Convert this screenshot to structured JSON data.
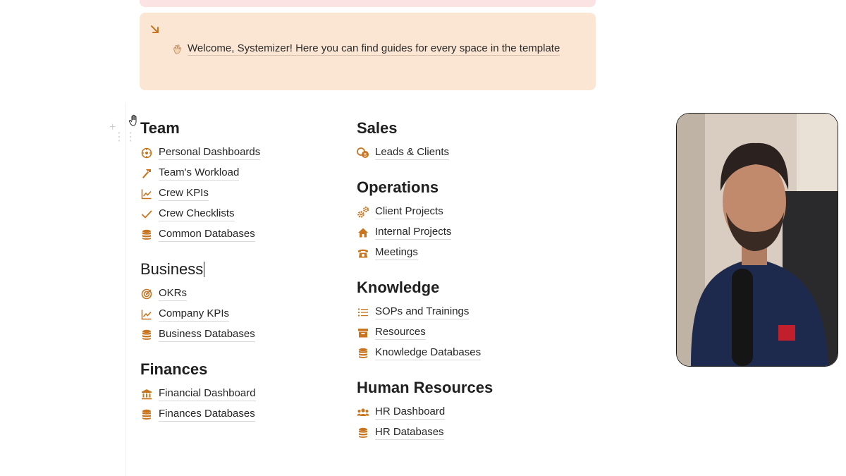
{
  "callout": {
    "text": "Welcome, Systemizer! Here you can find guides for every space in the template",
    "accent": "#c9741f"
  },
  "left_column": [
    {
      "heading": "Team",
      "items": [
        {
          "label": "Personal Dashboards",
          "icon": "dashboard-icon"
        },
        {
          "label": "Team's Workload",
          "icon": "hammer-icon"
        },
        {
          "label": "Crew KPIs",
          "icon": "trend-icon"
        },
        {
          "label": "Crew Checklists",
          "icon": "check-icon"
        },
        {
          "label": "Common Databases",
          "icon": "database-icon"
        }
      ]
    },
    {
      "heading": "Business",
      "items": [
        {
          "label": "OKRs",
          "icon": "target-icon"
        },
        {
          "label": "Company KPIs",
          "icon": "trend-icon"
        },
        {
          "label": "Business Databases",
          "icon": "database-icon"
        }
      ]
    },
    {
      "heading": "Finances",
      "items": [
        {
          "label": "Financial Dashboard",
          "icon": "bank-icon"
        },
        {
          "label": "Finances Databases",
          "icon": "database-icon"
        }
      ]
    }
  ],
  "right_column": [
    {
      "heading": "Sales",
      "items": [
        {
          "label": "Leads & Clients",
          "icon": "coins-icon"
        }
      ]
    },
    {
      "heading": "Operations",
      "items": [
        {
          "label": "Client Projects",
          "icon": "gears-icon"
        },
        {
          "label": "Internal Projects",
          "icon": "house-icon"
        },
        {
          "label": "Meetings",
          "icon": "phone-icon"
        }
      ]
    },
    {
      "heading": "Knowledge",
      "items": [
        {
          "label": "SOPs and Trainings",
          "icon": "list-icon"
        },
        {
          "label": "Resources",
          "icon": "archive-icon"
        },
        {
          "label": "Knowledge Databases",
          "icon": "database-icon"
        }
      ]
    },
    {
      "heading": "Human Resources",
      "items": [
        {
          "label": "HR Dashboard",
          "icon": "people-icon"
        },
        {
          "label": "HR Databases",
          "icon": "database-icon"
        }
      ]
    }
  ]
}
